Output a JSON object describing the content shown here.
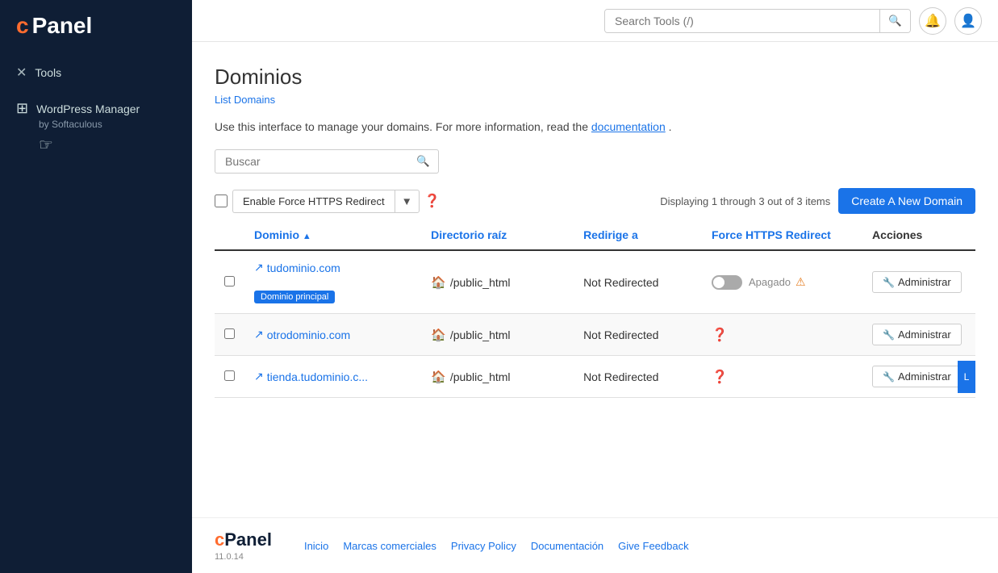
{
  "sidebar": {
    "logo": "cPanel",
    "items": [
      {
        "id": "tools",
        "label": "Tools",
        "icon": "✕"
      },
      {
        "id": "wordpress-manager",
        "label": "WordPress Manager",
        "sub": "by Softaculous"
      }
    ]
  },
  "topbar": {
    "search_placeholder": "Search Tools (/)",
    "search_value": ""
  },
  "page": {
    "title": "Dominios",
    "breadcrumb": "List Domains",
    "description_pre": "Use this interface to manage your domains. For more information, read the",
    "description_link": "documentation",
    "description_post": ".",
    "displaying": "Displaying 1 through 3 out of 3 items"
  },
  "table_search": {
    "placeholder": "Buscar"
  },
  "toolbar": {
    "https_button": "Enable Force HTTPS Redirect",
    "create_domain_button": "Create A New Domain"
  },
  "table": {
    "headers": [
      {
        "id": "dominio",
        "label": "Dominio",
        "sortable": true
      },
      {
        "id": "directorio",
        "label": "Directorio raíz"
      },
      {
        "id": "redirige",
        "label": "Redirige a"
      },
      {
        "id": "https",
        "label": "Force HTTPS Redirect"
      },
      {
        "id": "acciones",
        "label": "Acciones"
      }
    ],
    "rows": [
      {
        "domain": "tudominio.com",
        "badge": "Dominio principal",
        "directory": "/public_html",
        "redirect": "Not Redirected",
        "https_status": "toggle_off",
        "https_label": "Apagado",
        "https_warning": true,
        "admin_label": "Administrar"
      },
      {
        "domain": "otrodominio.com",
        "badge": null,
        "directory": "/public_html",
        "redirect": "Not Redirected",
        "https_status": "question",
        "https_label": "",
        "https_warning": false,
        "admin_label": "Administrar"
      },
      {
        "domain": "tienda.tudominio.c...",
        "badge": null,
        "directory": "/public_html",
        "redirect": "Not Redirected",
        "https_status": "question",
        "https_label": "",
        "https_warning": false,
        "admin_label": "Administrar"
      }
    ]
  },
  "footer": {
    "logo": "cPanel",
    "version": "11.0.14",
    "links": [
      "Inicio",
      "Marcas comerciales",
      "Privacy Policy",
      "Documentación",
      "Give Feedback"
    ]
  }
}
